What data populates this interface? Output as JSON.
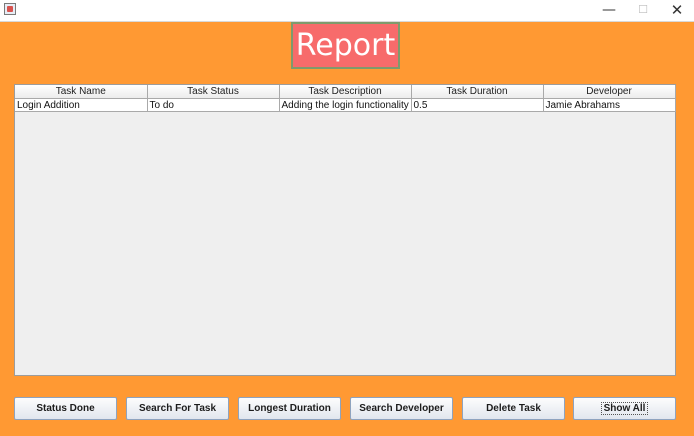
{
  "window": {
    "minimize_glyph": "—",
    "maximize_glyph": "☐",
    "close_glyph": "✕"
  },
  "header": {
    "title": "Report"
  },
  "table": {
    "columns": [
      "Task Name",
      "Task Status",
      "Task Description",
      "Task Duration",
      "Developer"
    ],
    "rows": [
      [
        "Login Addition",
        "To do",
        "Adding the login functionality",
        "0.5",
        "Jamie Abrahams"
      ]
    ]
  },
  "buttons": {
    "status_done": "Status Done",
    "search_task": "Search For Task",
    "longest_duration": "Longest Duration",
    "search_developer": "Search Developer",
    "delete_task": "Delete Task",
    "show_all": "Show All"
  },
  "colors": {
    "background": "#ff9933",
    "title_bg": "#f76b6b",
    "title_border": "#7f9a6c"
  }
}
